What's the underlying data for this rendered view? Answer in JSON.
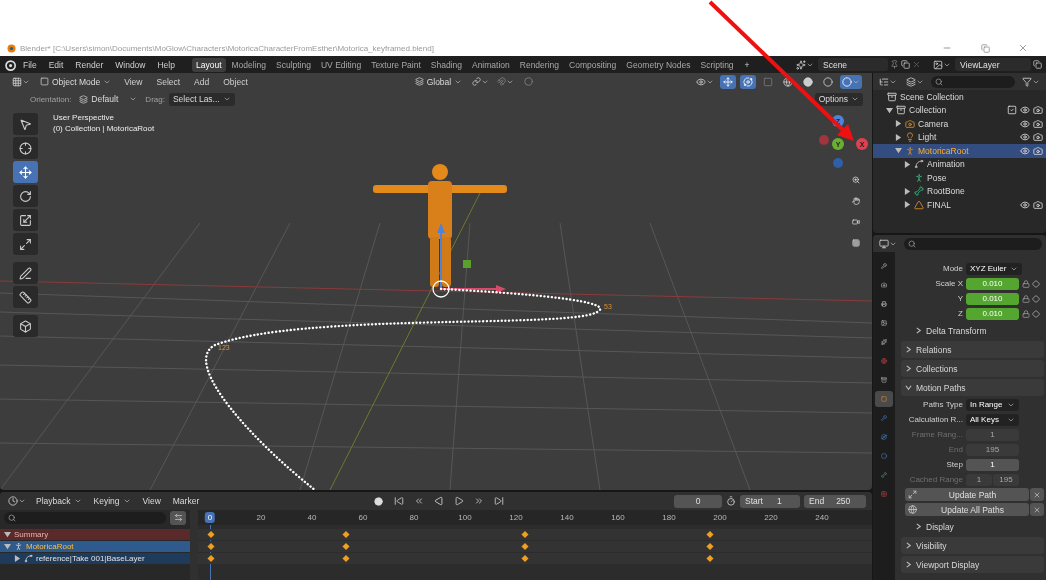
{
  "title_bar": {
    "title": "Blender* [C:\\Users\\simon\\Documents\\MoGlow\\Characters\\MotoricaCharacterFromEsther\\Motorica_keyframed.blend]"
  },
  "menu": [
    "File",
    "Edit",
    "Render",
    "Window",
    "Help"
  ],
  "workspaces": [
    {
      "label": "Layout",
      "selected": true
    },
    {
      "label": "Modeling",
      "selected": false
    },
    {
      "label": "Sculpting",
      "selected": false
    },
    {
      "label": "UV Editing",
      "selected": false
    },
    {
      "label": "Texture Paint",
      "selected": false
    },
    {
      "label": "Shading",
      "selected": false
    },
    {
      "label": "Animation",
      "selected": false
    },
    {
      "label": "Rendering",
      "selected": false
    },
    {
      "label": "Compositing",
      "selected": false
    },
    {
      "label": "Geometry Nodes",
      "selected": false
    },
    {
      "label": "Scripting",
      "selected": false
    }
  ],
  "add_workspace": "+",
  "scene": "Scene",
  "view_layer": "ViewLayer",
  "viewport": {
    "mode": "Object Mode",
    "menus": [
      "View",
      "Select",
      "Add",
      "Object"
    ],
    "transform_orientation": "Global",
    "orientation_label": "Orientation:",
    "orientation": "Default",
    "drag_label": "Drag:",
    "drag": "Select Las...",
    "options": "Options",
    "overlay_text": [
      "User Perspective",
      "(0) Collection | MotoricaRoot"
    ],
    "tools": [
      {
        "kind": "select",
        "selected": false
      },
      {
        "kind": "cursor",
        "selected": false
      },
      {
        "kind": "move",
        "selected": true
      },
      {
        "kind": "rotate",
        "selected": false
      },
      {
        "kind": "scale",
        "selected": false
      },
      {
        "kind": "transform",
        "selected": false
      },
      {
        "kind": "annotate",
        "selected": false
      },
      {
        "kind": "measure",
        "selected": false
      },
      {
        "kind": "add_cube",
        "selected": false
      }
    ],
    "gizmo_axes": [
      "X",
      "Y",
      "Z"
    ],
    "path_labels": [
      "123",
      "53"
    ]
  },
  "outliner": {
    "items": [
      {
        "label": "Scene Collection",
        "kind": "scene_collection",
        "children": [
          {
            "label": "Collection",
            "kind": "collection",
            "expanded": true,
            "checked": true,
            "toggles": true,
            "selected": false,
            "children": [
              {
                "label": "Camera",
                "kind": "camera",
                "expanded": false,
                "toggles": true,
                "selected": false
              },
              {
                "label": "Light",
                "kind": "light",
                "expanded": false,
                "toggles": true,
                "selected": false
              },
              {
                "label": "MotoricaRoot",
                "kind": "armature",
                "expanded": true,
                "toggles": true,
                "selected": true,
                "children": [
                  {
                    "label": "Animation",
                    "kind": "animation",
                    "expanded": false,
                    "toggles": false,
                    "selected": false
                  },
                  {
                    "label": "Pose",
                    "kind": "pose",
                    "toggles": false,
                    "selected": false
                  },
                  {
                    "label": "RootBone",
                    "kind": "bone",
                    "expanded": false,
                    "toggles": false,
                    "selected": false
                  },
                  {
                    "label": "FINAL",
                    "kind": "mesh",
                    "expanded": false,
                    "toggles": true,
                    "selected": false
                  }
                ]
              }
            ]
          }
        ]
      }
    ]
  },
  "properties": {
    "tabs": [
      {
        "kind": "tool",
        "selected": false
      },
      {
        "kind": "render",
        "selected": false
      },
      {
        "kind": "output",
        "selected": false
      },
      {
        "kind": "view_layer",
        "selected": false
      },
      {
        "kind": "scene",
        "selected": false
      },
      {
        "kind": "world",
        "selected": false
      },
      {
        "kind": "collection",
        "selected": false
      },
      {
        "kind": "object",
        "selected": true
      },
      {
        "kind": "modifiers",
        "selected": false
      },
      {
        "kind": "particles",
        "selected": false
      },
      {
        "kind": "physics",
        "selected": false
      },
      {
        "kind": "bone",
        "selected": false
      },
      {
        "kind": "texture",
        "selected": false
      }
    ],
    "transform_rows": [
      {
        "label": "Mode",
        "kind": "dropdown",
        "value": "XYZ Euler"
      },
      {
        "label": "Scale X",
        "kind": "animated",
        "value": "0.010"
      },
      {
        "label": "Y",
        "kind": "animated",
        "value": "0.010"
      },
      {
        "label": "Z",
        "kind": "animated",
        "value": "0.010"
      }
    ],
    "delta_transform": {
      "title": "Delta Transform",
      "expanded": false
    },
    "panels": [
      {
        "title": "Relations",
        "expanded": false
      },
      {
        "title": "Collections",
        "expanded": false
      },
      {
        "title": "Motion Paths",
        "expanded": true,
        "rows": [
          {
            "label": "Paths Type",
            "kind": "dropdown",
            "value": "In Range",
            "disabled": false
          },
          {
            "label": "Calculation R...",
            "kind": "dropdown",
            "value": "All Keys",
            "disabled": false
          },
          {
            "label": "Frame Rang...",
            "kind": "number",
            "value": "1",
            "disabled": true
          },
          {
            "label": "End",
            "kind": "number",
            "value": "195",
            "disabled": true
          },
          {
            "label": "Step",
            "kind": "number",
            "value": "1",
            "disabled": false
          },
          {
            "label": "Cached Range",
            "kind": "pair",
            "values": [
              "1",
              "195"
            ],
            "disabled": true
          }
        ],
        "buttons": [
          {
            "label": "Update Path",
            "kind": "selected"
          },
          {
            "label": "Update All Paths",
            "kind": "all"
          }
        ],
        "subpanel": {
          "title": "Display",
          "expanded": false
        }
      },
      {
        "title": "Visibility",
        "expanded": false
      },
      {
        "title": "Viewport Display",
        "expanded": false
      }
    ]
  },
  "timeline": {
    "menus": [
      {
        "label": "Playback",
        "dropdown": true
      },
      {
        "label": "Keying",
        "dropdown": true
      },
      {
        "label": "View",
        "dropdown": false
      },
      {
        "label": "Marker",
        "dropdown": false
      }
    ],
    "current_frame": "0",
    "start_label": "Start",
    "start": "1",
    "end_label": "End",
    "end": "250",
    "ruler": [
      {
        "label": "0",
        "selected": true
      },
      {
        "label": "20",
        "selected": false
      },
      {
        "label": "40",
        "selected": false
      },
      {
        "label": "60",
        "selected": false
      },
      {
        "label": "80",
        "selected": false
      },
      {
        "label": "100",
        "selected": false
      },
      {
        "label": "120",
        "selected": false
      },
      {
        "label": "140",
        "selected": false
      },
      {
        "label": "160",
        "selected": false
      },
      {
        "label": "180",
        "selected": false
      },
      {
        "label": "200",
        "selected": false
      },
      {
        "label": "220",
        "selected": false
      },
      {
        "label": "240",
        "selected": false
      }
    ],
    "channels": [
      {
        "label": "Summary",
        "kind": "summary",
        "expanded": true,
        "keyframes": [
          {
            "level": 0.019
          },
          {
            "level": 0.219
          },
          {
            "level": 0.485
          },
          {
            "level": 0.759
          }
        ]
      },
      {
        "label": "MotoricaRoot",
        "kind": "object",
        "expanded": true,
        "keyframes": [
          {
            "level": 0.019
          },
          {
            "level": 0.219
          },
          {
            "level": 0.485
          },
          {
            "level": 0.759
          }
        ]
      },
      {
        "label": "reference|Take 001|BaseLayer",
        "kind": "action",
        "expanded": false,
        "keyframes": [
          {
            "level": 0.019
          },
          {
            "level": 0.219
          },
          {
            "level": 0.485
          },
          {
            "level": 0.759
          }
        ]
      }
    ]
  }
}
